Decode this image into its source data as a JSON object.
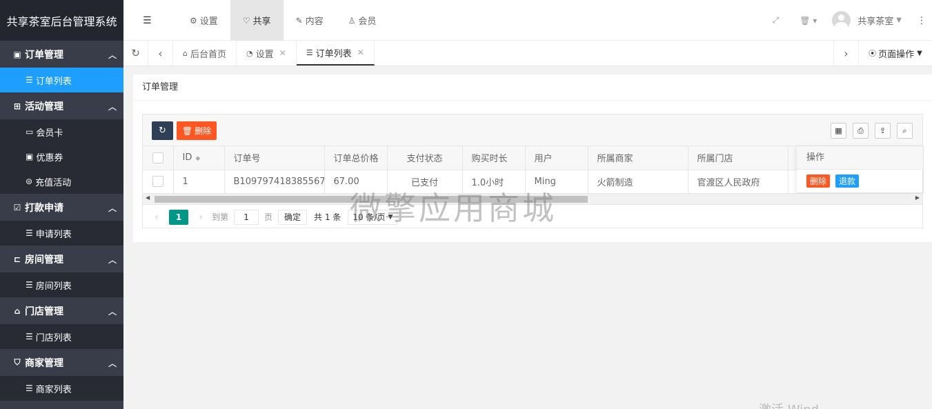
{
  "app": {
    "title": "共享茶室后台管理系统"
  },
  "sidebar": {
    "groups": [
      {
        "label": "订单管理",
        "items": [
          {
            "label": "订单列表",
            "active": true
          }
        ]
      },
      {
        "label": "活动管理",
        "items": [
          {
            "label": "会员卡"
          },
          {
            "label": "优惠券"
          },
          {
            "label": "充值活动"
          }
        ]
      },
      {
        "label": "打款申请",
        "items": [
          {
            "label": "申请列表"
          }
        ]
      },
      {
        "label": "房间管理",
        "items": [
          {
            "label": "房间列表"
          }
        ]
      },
      {
        "label": "门店管理",
        "items": [
          {
            "label": "门店列表"
          }
        ]
      },
      {
        "label": "商家管理",
        "items": [
          {
            "label": "商家列表"
          }
        ]
      }
    ]
  },
  "header": {
    "nav": [
      {
        "label": "设置"
      },
      {
        "label": "共享",
        "active": true
      },
      {
        "label": "内容"
      },
      {
        "label": "会员"
      }
    ],
    "username": "共享茶室"
  },
  "tabs": {
    "items": [
      {
        "label": "后台首页"
      },
      {
        "label": "设置"
      },
      {
        "label": "订单列表",
        "active": true
      }
    ],
    "page_ops": "页面操作"
  },
  "main": {
    "card_title": "订单管理",
    "toolbar": {
      "delete_label": "删除"
    },
    "table": {
      "columns": [
        "ID",
        "订单号",
        "订单总价格",
        "支付状态",
        "购买时长",
        "用户",
        "所属商家",
        "所属门店",
        "操作"
      ],
      "rows": [
        {
          "id": "1",
          "order_no": "B109797418385567",
          "total": "67.00",
          "pay_status": "已支付",
          "duration": "1.0小时",
          "user": "Ming",
          "merchant": "火箭制造",
          "store": "官渡区人民政府",
          "op_delete": "删除",
          "op_refund": "退款"
        }
      ]
    },
    "pager": {
      "current": "1",
      "goto_label": "到第",
      "goto_value": "1",
      "page_label": "页",
      "confirm": "确定",
      "total": "共 1 条",
      "page_size": "10 条/页"
    }
  },
  "watermark": "微擎应用商城",
  "activate_text": "激活 Wind"
}
